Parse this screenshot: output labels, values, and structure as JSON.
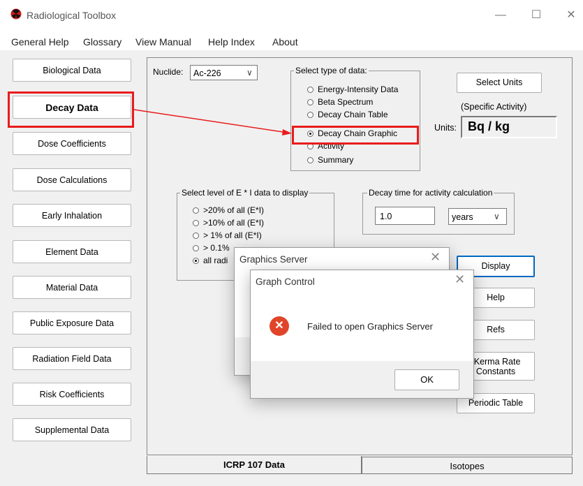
{
  "window": {
    "title": "Radiological Toolbox",
    "minimize": "—",
    "maximize": "☐",
    "close": "✕"
  },
  "menu": [
    "General Help",
    "Glossary",
    "View Manual",
    "Help Index",
    "About"
  ],
  "sidebar": [
    {
      "label": "Biological Data"
    },
    {
      "label": "Decay Data"
    },
    {
      "label": "Dose Coefficients"
    },
    {
      "label": "Dose Calculations"
    },
    {
      "label": "Early Inhalation"
    },
    {
      "label": "Element Data"
    },
    {
      "label": "Material Data"
    },
    {
      "label": "Public Exposure Data"
    },
    {
      "label": "Radiation Field Data"
    },
    {
      "label": "Risk Coefficients"
    },
    {
      "label": "Supplemental Data"
    }
  ],
  "nuclide": {
    "label": "Nuclide:",
    "value": "Ac-226",
    "arrow": "∨"
  },
  "data_type": {
    "label": "Select type of data:",
    "options": [
      "Energy-Intensity Data",
      "Beta Spectrum",
      "Decay Chain Table",
      "Decay Chain Graphic",
      "Activity",
      "Summary"
    ],
    "selected_index": 3
  },
  "units": {
    "button": "Select Units",
    "subtitle": "(Specific Activity)",
    "label": "Units:",
    "value": "Bq / kg"
  },
  "level": {
    "label": "Select level of E * I data to display",
    "options": [
      ">20% of all (E*I)",
      ">10% of all (E*I)",
      "> 1% of all (E*I)",
      "> 0.1%",
      "all radi"
    ],
    "selected_index": 4
  },
  "decay_time": {
    "label": "Decay time for activity calculation",
    "value": "1.0",
    "unit": "years",
    "arrow": "∨"
  },
  "buttons": {
    "display": "Display",
    "help": "Help",
    "refs": "Refs",
    "kerma_line1": "-Kerma Rate",
    "kerma_line2": "Constants",
    "periodic": "Periodic Table"
  },
  "tabs": {
    "icrp": "ICRP 107 Data",
    "isotopes": "Isotopes"
  },
  "graphics_server_dialog": {
    "title": "Graphics Server",
    "close": "✕"
  },
  "graph_control_dialog": {
    "title": "Graph Control",
    "close": "✕",
    "message": "Failed to open Graphics Server",
    "ok": "OK",
    "error_glyph": "✕"
  },
  "colors": {
    "highlight": "#e81c1c",
    "accent": "#0067c0",
    "error": "#e0452a"
  }
}
